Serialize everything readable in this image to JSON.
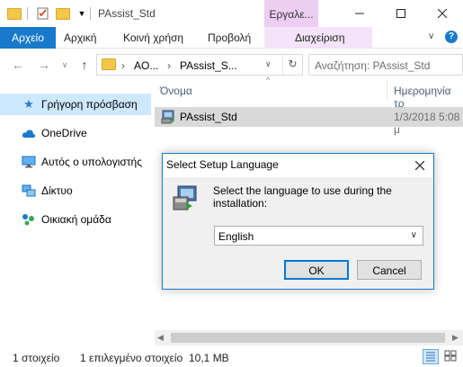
{
  "title_bar": {
    "title": "PAssist_Std",
    "context_tab_label": "Εργαλε..."
  },
  "ribbon": {
    "tabs": [
      "Αρχείο",
      "Αρχική",
      "Κοινή χρήση",
      "Προβολή",
      "Διαχείριση"
    ]
  },
  "address_bar": {
    "crumb_1": "AO...",
    "crumb_2": "PAssist_S...",
    "search_placeholder": "Αναζήτηση: PAssist_Std"
  },
  "nav_pane": {
    "items": [
      {
        "label": "Γρήγορη πρόσβαση",
        "icon": "star-icon"
      },
      {
        "label": "OneDrive",
        "icon": "cloud-icon"
      },
      {
        "label": "Αυτός ο υπολογιστής",
        "icon": "computer-icon"
      },
      {
        "label": "Δίκτυο",
        "icon": "network-icon"
      },
      {
        "label": "Οικιακή ομάδα",
        "icon": "homegroup-icon"
      }
    ]
  },
  "file_list": {
    "headers": {
      "name": "Όνομα",
      "date": "Ημερομηνία τρ"
    },
    "rows": [
      {
        "name": "PAssist_Std",
        "date": "1/3/2018 5:08 μ"
      }
    ]
  },
  "dialog": {
    "title": "Select Setup Language",
    "message": "Select the language to use during the installation:",
    "selected_language": "English",
    "ok_label": "OK",
    "cancel_label": "Cancel"
  },
  "status_bar": {
    "item_count": "1 στοιχείο",
    "selection": "1 επιλεγμένο στοιχείο",
    "size": "10,1 MB"
  },
  "colors": {
    "accent": "#1979ca",
    "context_tab": "#eccef3",
    "selection": "#cde8ff"
  }
}
